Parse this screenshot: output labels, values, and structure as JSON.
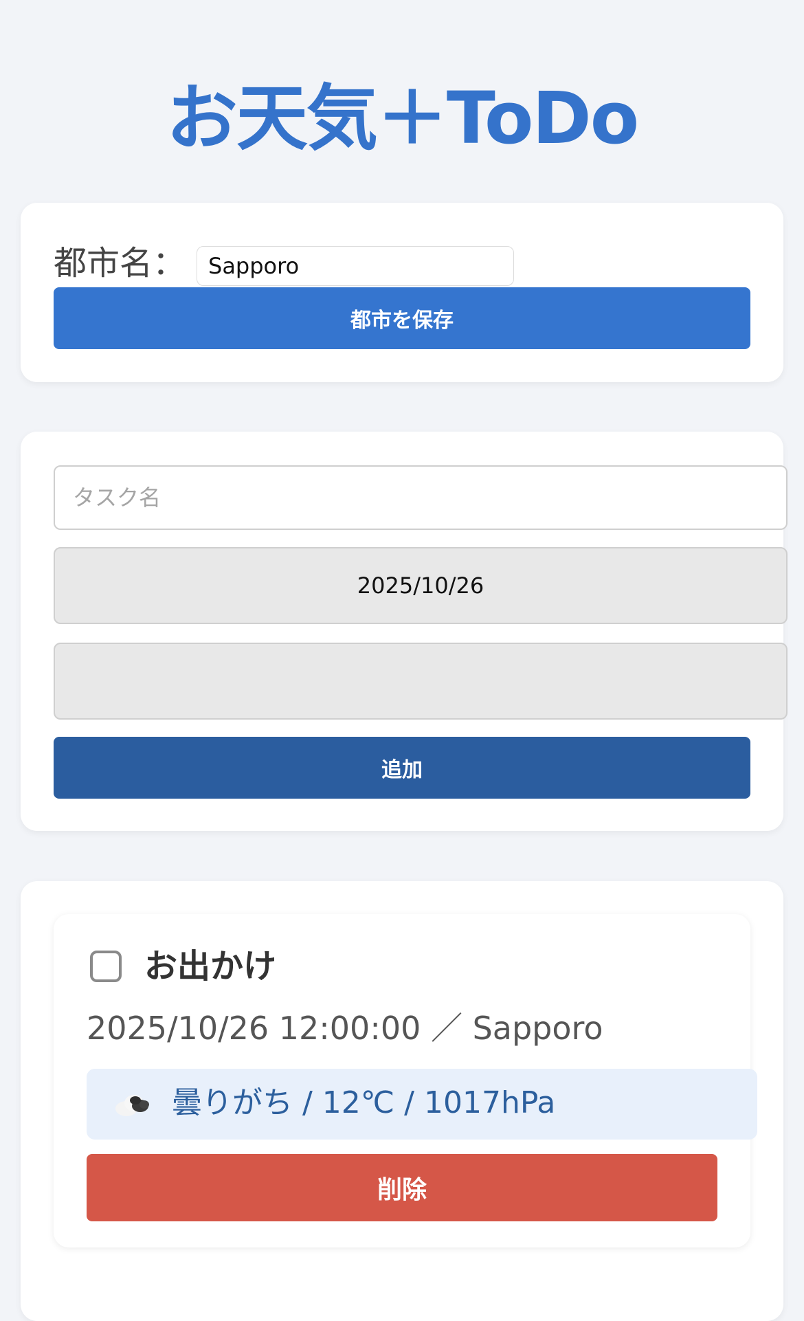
{
  "app": {
    "title": "お天気＋ToDo"
  },
  "city": {
    "label": "都市名：",
    "value": "Sapporo",
    "save_label": "都市を保存"
  },
  "form": {
    "task_placeholder": "タスク名",
    "date_value": "2025/10/26",
    "time_value": "",
    "add_label": "追加"
  },
  "todos": [
    {
      "title": "お出かけ",
      "checked": false,
      "meta": "2025/10/26 12:00:00 ／ Sapporo",
      "weather_icon": "cloud-icon",
      "weather": "曇りがち / 12℃ / 1017hPa",
      "delete_label": "削除"
    }
  ],
  "colors": {
    "accent": "#3573cb",
    "add_button": "#2b5d9f",
    "delete_button": "#d55748",
    "weather_bg": "#e8f0fb"
  }
}
